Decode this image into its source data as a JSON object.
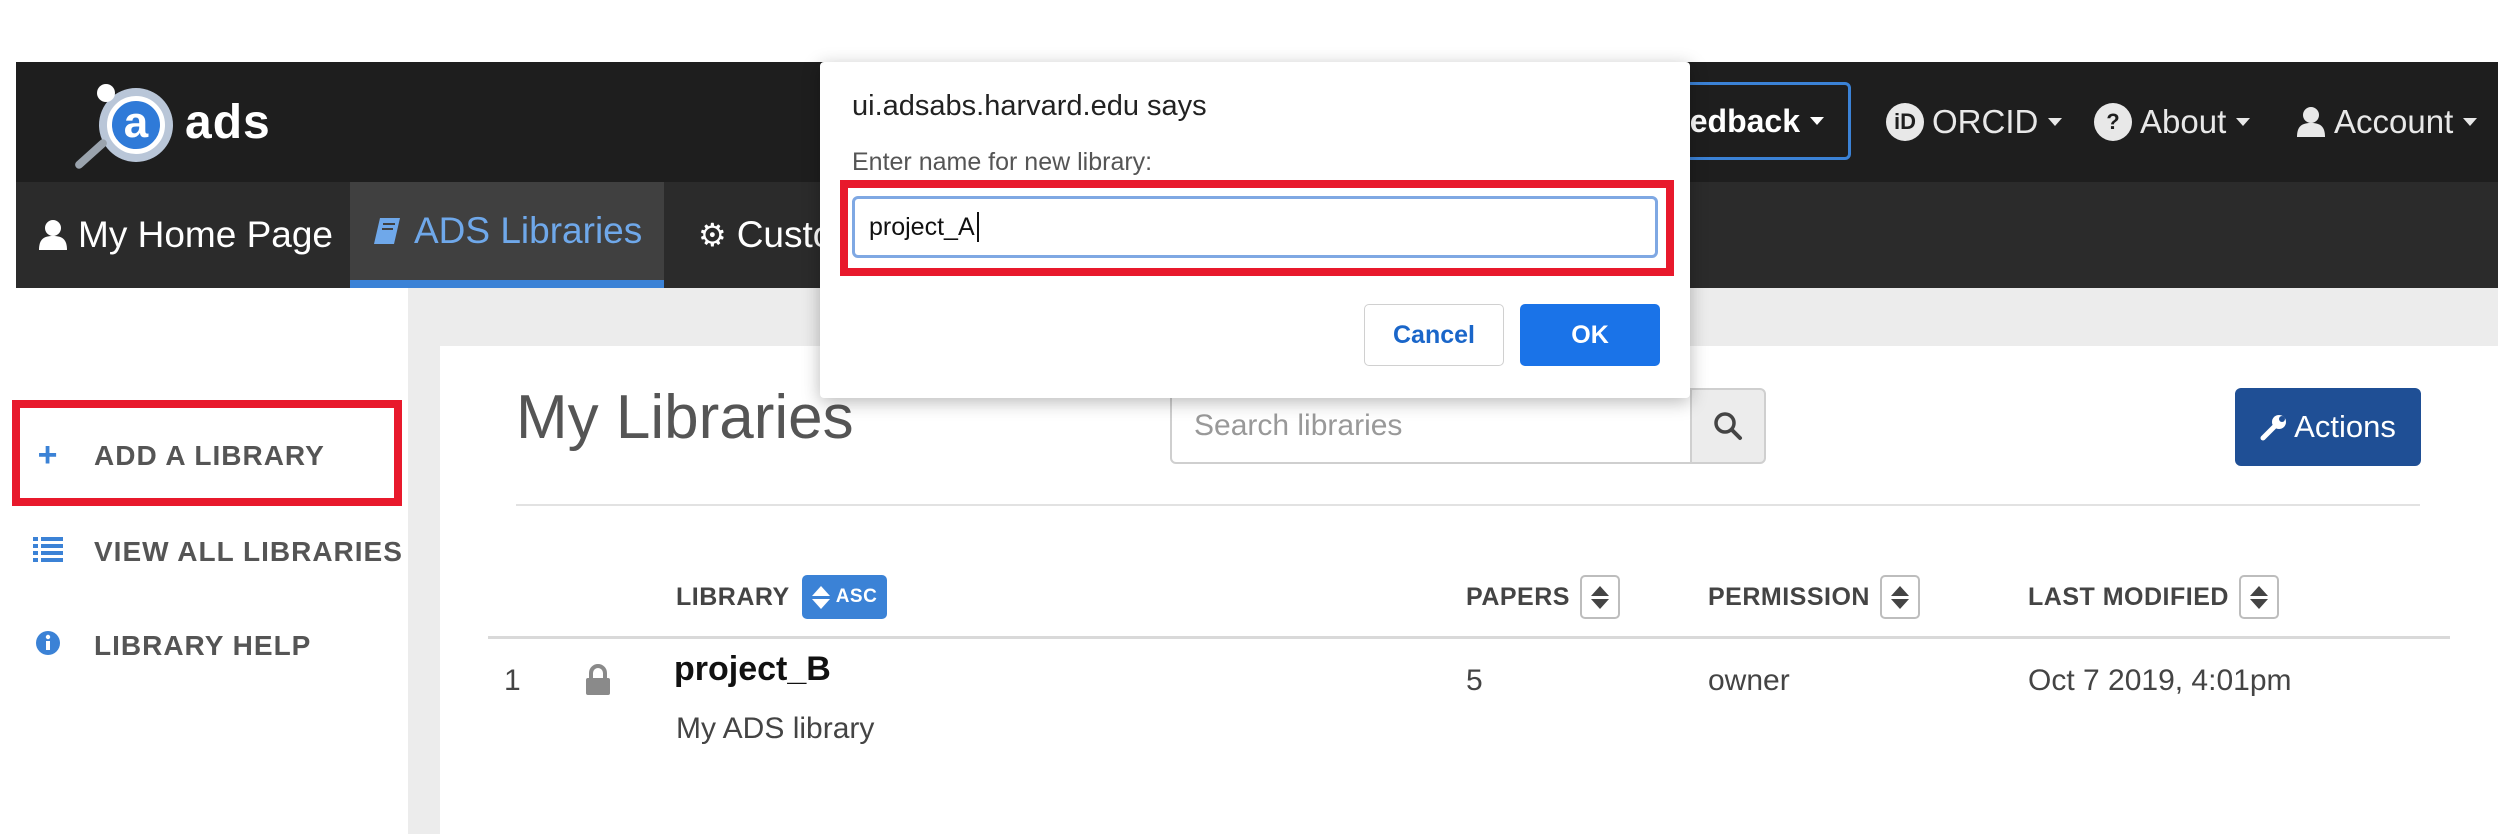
{
  "header": {
    "logo_text": "ads",
    "logo_letter": "a",
    "feedback_label": "edback",
    "orcid_label": "ORCID",
    "orcid_icon_text": "iD",
    "about_label": "About",
    "about_icon_text": "?",
    "account_label": "Account"
  },
  "subnav": {
    "tabs": [
      {
        "label": "My Home Page",
        "icon": "user-icon"
      },
      {
        "label": "ADS Libraries",
        "icon": "book-icon",
        "active": true
      },
      {
        "label": "Custo",
        "icon": "gear-icon"
      }
    ]
  },
  "sidebar": {
    "items": [
      {
        "label": "ADD A LIBRARY",
        "icon": "plus-icon",
        "icon_glyph": "+"
      },
      {
        "label": "VIEW ALL LIBRARIES",
        "icon": "list-icon",
        "icon_glyph": "≡"
      },
      {
        "label": "LIBRARY HELP",
        "icon": "info-icon",
        "icon_glyph": "i"
      }
    ]
  },
  "main": {
    "title": "My Libraries",
    "search_placeholder": "Search libraries",
    "actions_label": "Actions",
    "columns": {
      "library": "LIBRARY",
      "sort_badge": "ASC",
      "papers": "PAPERS",
      "permission": "PERMISSION",
      "last_modified": "LAST MODIFIED"
    },
    "rows": [
      {
        "index": "1",
        "name": "project_B",
        "description": "My ADS library",
        "papers": "5",
        "permission": "owner",
        "last_modified": "Oct 7 2019, 4:01pm"
      }
    ]
  },
  "dialog": {
    "title": "ui.adsabs.harvard.edu says",
    "label": "Enter name for new library:",
    "input_value": "project_A",
    "cancel_label": "Cancel",
    "ok_label": "OK"
  },
  "colors": {
    "highlight": "#e8192c",
    "accent": "#3b82d6",
    "navbar": "#1e1e1e",
    "ok_button": "#1a73e8",
    "actions_button": "#1f4f95"
  }
}
